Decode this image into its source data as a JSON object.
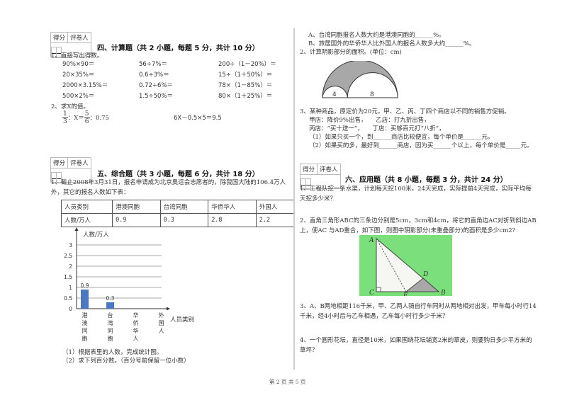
{
  "score_box": {
    "col1": "得分",
    "col2": "评卷人"
  },
  "section4": {
    "title": "四、计算题（共 2 小题，每题 5 分，共计 10 分）",
    "q1_label": "1、直接写出得数。",
    "q1_rows": [
      [
        "90%×90＝",
        "56÷7%＝",
        "200÷（1－20%）＝"
      ],
      [
        "20×35%＝",
        "0.6÷3%＝",
        "15÷（1＋50%）＝"
      ],
      [
        "2000×3.15%＝",
        "0.72÷6%＝",
        "78×（1－85%）＝"
      ],
      [
        "500×2%＝",
        "1.5÷50%＝",
        "80×（1＋25%）＝"
      ]
    ],
    "q2_label": "2、求X的值。",
    "q2_frac1_num": "1",
    "q2_frac1_den": "3",
    "q2_mid": "：X＝",
    "q2_frac2_num": "5",
    "q2_frac2_den": "6",
    "q2_tail": "：0.75",
    "q2_eq2": "6X－0.5×5＝9.5"
  },
  "section5": {
    "title": "五、综合题（共 3 小题，每题 6 分，共计 18 分）",
    "q1_text": "1、截止2008年3月31日，报名申请成为北京奥运会志愿者的，除我国大陆的106.4万人外，其它的报名人数如下表：",
    "table": {
      "header": [
        "人员类别",
        "港澳同胞",
        "台湾同胞",
        "华侨华人",
        "外国人"
      ],
      "row": [
        "人数/万人",
        "0.9",
        "0.3",
        "2.8",
        "2.2"
      ]
    },
    "sub1": "（1）根据表里的人数，完成统计图。",
    "sub2": "（2）求下列百分数。（百分号前保留一位小数）",
    "subA": "A、台湾同胞报名人数大约是港澳同胞的______%。",
    "subB": "B、旅居国外的华侨华人比外国人的报名人数多大约______%。",
    "q2_text": "2、计算阴影部分的面积。(单位：cm)",
    "q2_fig_labels": [
      "4",
      "8"
    ],
    "q3_lines": [
      "3、某种商品，原定价为20元，甲、乙、丙、丁四个商店以不同的销售方促销。",
      "甲店：降价9%出售，　　乙店：打九折出售，",
      "丙店：“买十送一”，　　丁店：买够百元打“八折”，",
      "（1）如果只买一个，到______商店比较便宜，每个单价是______元。",
      "（2）如果买的多，最好到______商店，因为买______个以上，每个单价是_____元。"
    ]
  },
  "chart_data": {
    "type": "bar",
    "title": "",
    "ylabel": "人数/万人",
    "xlabel": "人员类别",
    "categories": [
      "港澳同胞",
      "台湾同胞",
      "华侨华人",
      "外国人"
    ],
    "values": [
      0.9,
      0.3,
      null,
      null
    ],
    "data_labels": [
      "0.9",
      "0.3",
      "",
      ""
    ],
    "ylim": [
      0,
      3
    ],
    "yticks": [
      "0",
      "0.5",
      "1",
      "1.5",
      "2",
      "2.5",
      "3"
    ],
    "grid": true,
    "bar_color": "#4a78c2"
  },
  "section6": {
    "title": "六、应用题（共 8 小题，每题 3 分，共计 24 分）",
    "q1": "1、工程队挖一条水渠，计划每天挖100米，24天完成，实际提前4天完成，实际平均每天挖多少米？",
    "q2": "2、直角三角形ABC的三条边分别是5cm，3cm和4cm，将它的直角边AC对折到斜边AB上，使AC 与AD重合，如下图，则图中阴影部分(未重叠部分)的面积是多少cm2?",
    "q2_fig_labels": {
      "A": "A",
      "B": "B",
      "C": "C",
      "D": "D",
      "E": "E"
    },
    "q3": "3、A、B两地相距116千米，甲、乙两人骑自行车同时从两地相对出发，甲车每小时行14千米，经4小时后与乙车相遇，乙车每小时行多少千米？",
    "q4": "4、一个圆形花坛，直径是10米，如果围绕花坛铺宽2米的草皮，则要购日多少平方米的草坪？"
  },
  "footer": {
    "page": "第 2 页 共 5 页"
  },
  "colors": {
    "figure_green": "#7be07b",
    "shade_gray": "#a8a8a8"
  }
}
